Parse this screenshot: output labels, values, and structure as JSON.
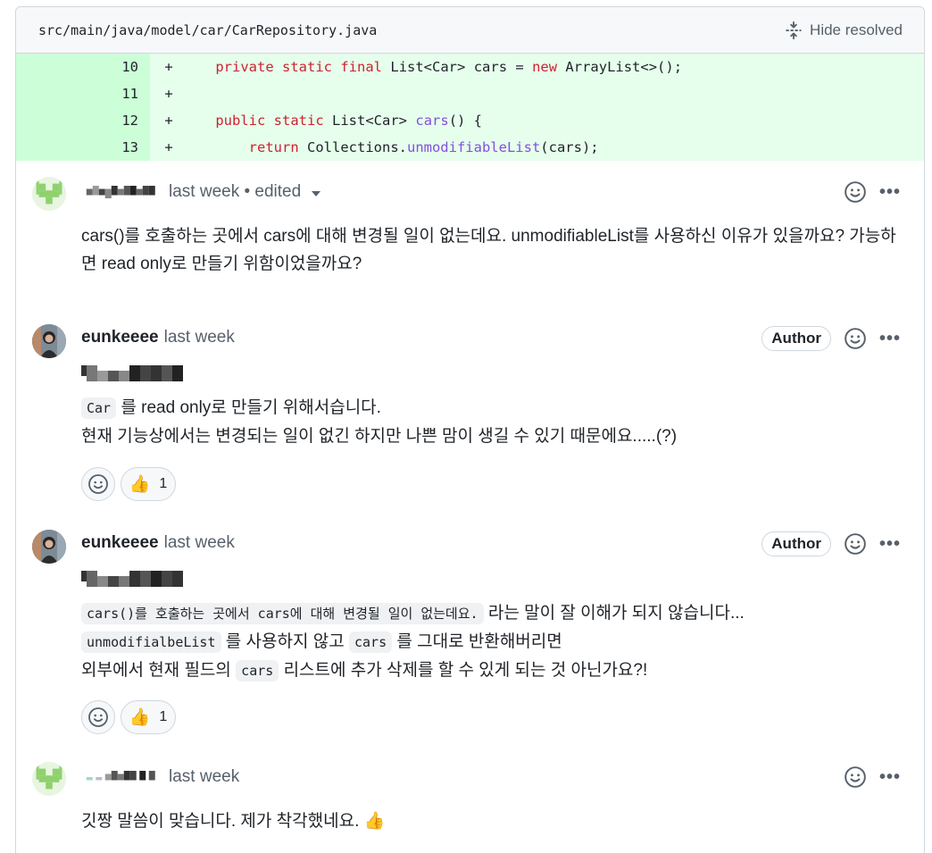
{
  "file": {
    "path": "src/main/java/model/car/CarRepository.java",
    "hide_resolved_label": "Hide resolved"
  },
  "code_lines": [
    {
      "num": "10",
      "sign": "+"
    },
    {
      "num": "11",
      "sign": "+"
    },
    {
      "num": "12",
      "sign": "+"
    },
    {
      "num": "13",
      "sign": "+"
    }
  ],
  "code_tokens": {
    "l10_private": "private",
    "l10_static": "static",
    "l10_final": "final",
    "l10_type": "List<Car>",
    "l10_name": "cars",
    "l10_eq": "=",
    "l10_new": "new",
    "l10_rest": "ArrayList<>();",
    "l12_public": "public",
    "l12_static": "static",
    "l12_type": "List<Car>",
    "l12_fn": "cars",
    "l12_rest": "() {",
    "l13_return": "return",
    "l13_obj": "Collections.",
    "l13_fn": "unmodifiableList",
    "l13_rest": "(cars);"
  },
  "comments": [
    {
      "meta": "last week • edited",
      "text": "cars()를 호출하는 곳에서 cars에 대해 변경될 일이 없는데요. unmodifiableList를 사용하신 이유가 있을까요? 가능하면 read only로 만들기 위함이었을까요?"
    },
    {
      "author": "eunkeeee",
      "meta": "last week",
      "badge": "Author",
      "line1_chip": "Car",
      "line1_text": "를 read only로 만들기 위해서습니다.",
      "line2": "현재 기능상에서는 변경되는 일이 없긴 하지만 나쁜 맘이 생길 수 있기 때문에요.....(?)",
      "reaction_count": "1"
    },
    {
      "author": "eunkeeee",
      "meta": "last week",
      "badge": "Author",
      "chip1": "cars()를 호출하는 곳에서 cars에 대해 변경될 일이 없는데요.",
      "text1": "라는 말이 잘 이해가 되지 않습니다...",
      "chip2": "unmodifialbeList",
      "text2a": "를 사용하지 않고",
      "chip3": "cars",
      "text2b": "를 그대로 반환해버리면",
      "text3a": "외부에서 현재 필드의",
      "chip4": "cars",
      "text3b": "리스트에 추가 삭제를 할 수 있게 되는 것 아닌가요?!",
      "reaction_count": "1"
    },
    {
      "meta": "last week",
      "text": "깃짱 말씀이 맞습니다. 제가 착각했네요."
    }
  ],
  "colors": {
    "added_bg": "#e6ffec",
    "added_num_bg": "#ccffd8",
    "keyword": "#cf222e",
    "function": "#8250df"
  }
}
